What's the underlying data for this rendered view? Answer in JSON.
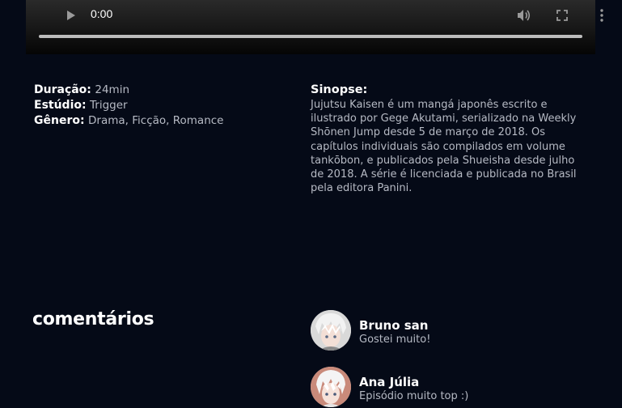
{
  "player": {
    "time": "0:00",
    "icons": [
      "play-icon",
      "volume-icon",
      "fullscreen-icon",
      "more-vertical-icon"
    ]
  },
  "info": {
    "duration_label": "Duração:",
    "duration_value": "24min",
    "studio_label": "Estúdio:",
    "studio_value": "Trigger",
    "genre_label": "Gênero:",
    "genre_value": "Drama, Ficção, Romance"
  },
  "synopsis": {
    "label": "Sinopse:",
    "text": "Jujutsu Kaisen é um mangá japonês escrito e ilustrado por Gege Akutami, serializado na Weekly Shōnen Jump desde 5 de março de 2018. Os capítulos individuais são compilados em volume tankōbon, e publicados pela Shueisha desde julho de 2018. A série é licenciada e publicada no Brasil pela editora Panini."
  },
  "comments": {
    "title": "comentários",
    "items": [
      {
        "name": "Bruno san",
        "message": "Gostei muito!"
      },
      {
        "name": "Ana Júlia",
        "message": "Episódio muito top :)"
      }
    ]
  },
  "colors": {
    "background": "#050a17",
    "muted_text": "#b6bac4"
  }
}
